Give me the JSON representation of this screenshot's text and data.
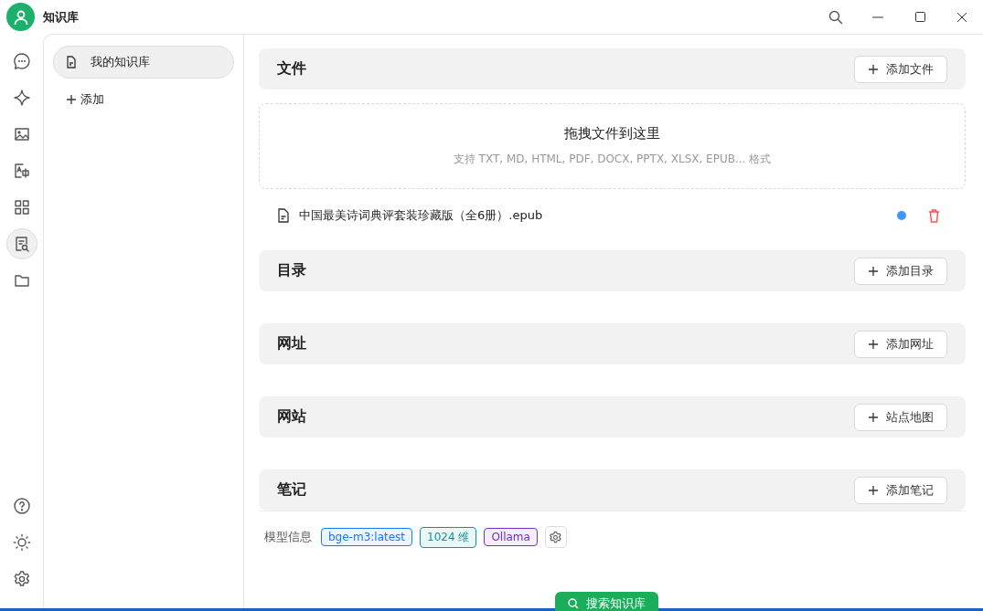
{
  "window": {
    "title": "知识库"
  },
  "rail": {
    "items": [
      {
        "kind": "chat",
        "selected": false
      },
      {
        "kind": "assistant",
        "selected": false
      },
      {
        "kind": "paint",
        "selected": false
      },
      {
        "kind": "translate",
        "selected": false
      },
      {
        "kind": "apps",
        "selected": false
      },
      {
        "kind": "knowledge",
        "selected": true
      },
      {
        "kind": "files",
        "selected": false
      }
    ],
    "bottom": [
      {
        "kind": "help"
      },
      {
        "kind": "theme"
      },
      {
        "kind": "settings"
      }
    ]
  },
  "sidebar": {
    "items": [
      {
        "label": "我的知识库",
        "selected": true
      }
    ],
    "add": "添加"
  },
  "sections": [
    {
      "title": "文件",
      "button": "添加文件",
      "dropzone": {
        "title": "拖拽文件到这里",
        "hint": "支持 TXT, MD, HTML, PDF, DOCX, PPTX, XLSX, EPUB... 格式"
      },
      "files": [
        {
          "name": "中国最美诗词典评套装珍藏版（全6册）.epub",
          "color": "#4096ff"
        }
      ]
    },
    {
      "title": "目录",
      "button": "添加目录"
    },
    {
      "title": "网址",
      "button": "添加网址"
    },
    {
      "title": "网站",
      "button": "站点地图"
    },
    {
      "title": "笔记",
      "button": "添加笔记"
    }
  ],
  "model_info": {
    "label": "模型信息",
    "tags": [
      {
        "text": "bge-m3:latest",
        "color": "#1677ff"
      },
      {
        "text": "1024 维",
        "color": "#08979c"
      },
      {
        "text": "Ollama",
        "color": "#722ed1"
      }
    ]
  },
  "search_button": "搜索知识库"
}
